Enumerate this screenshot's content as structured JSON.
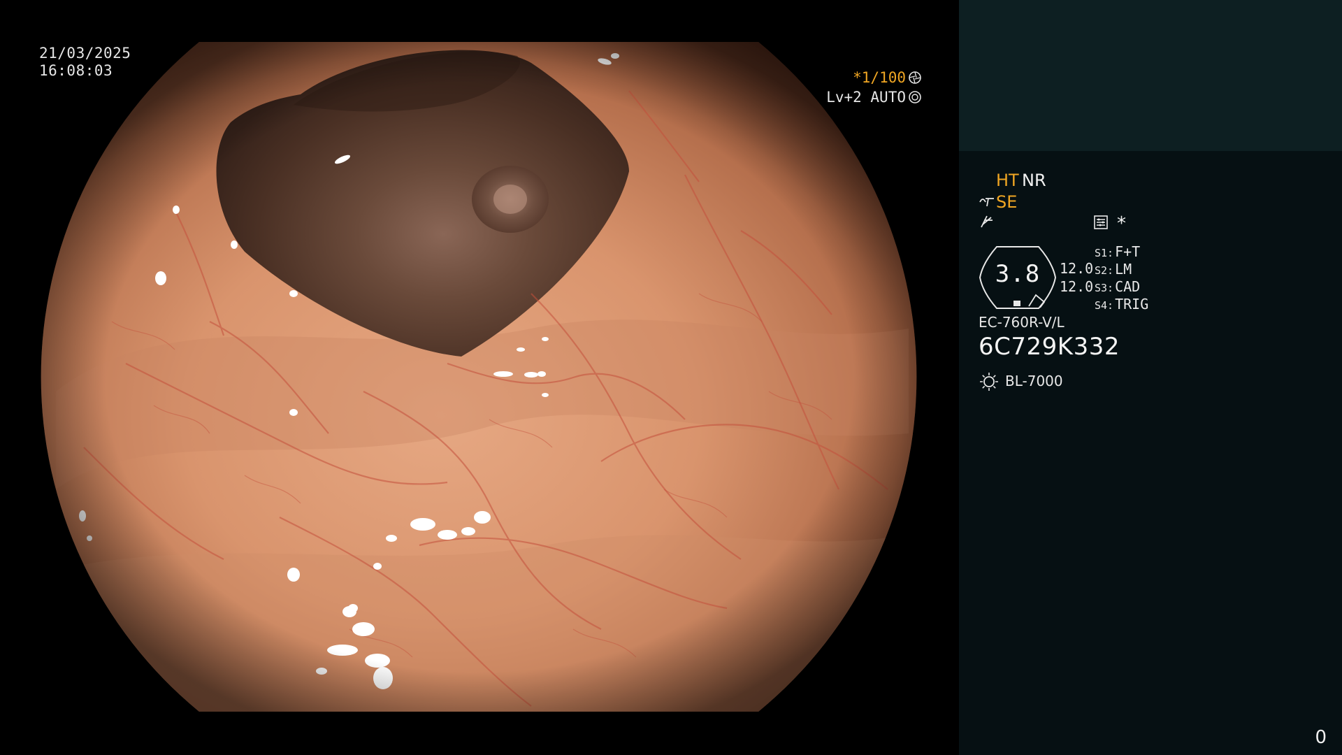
{
  "overlay": {
    "date": "21/03/2025",
    "time": "16:08:03",
    "shutter": "*1/100",
    "level": "Lv+2 AUTO"
  },
  "panel": {
    "ht": "HT",
    "nr": "NR",
    "se": "SE",
    "asterisk": "*",
    "iris_value": "3.8",
    "value_a": "12.0",
    "value_b": "12.0",
    "slots": [
      {
        "key": "S1:",
        "value": "F+T"
      },
      {
        "key": "S2:",
        "value": "LM"
      },
      {
        "key": "S3:",
        "value": "CAD"
      },
      {
        "key": "S4:",
        "value": "TRIG"
      }
    ],
    "scope_model": "EC-760R-V/L",
    "serial": "6C729K332",
    "light_source": "BL-7000",
    "counter": "0"
  },
  "icons": {
    "shutter": "aperture-icon",
    "level": "auto-iris-icon",
    "structure": "se-icon",
    "enhancement": "enhancement-icon",
    "settings": "settings-icon",
    "light": "light-source-icon"
  },
  "colors": {
    "accent_orange": "#f0a623",
    "panel_header": "#0d1f22",
    "panel_body": "#061013"
  }
}
